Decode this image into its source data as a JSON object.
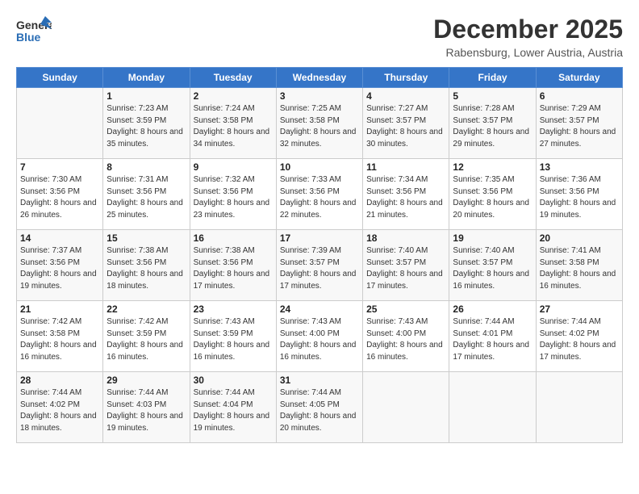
{
  "logo": {
    "line1": "General",
    "line2": "Blue"
  },
  "title": "December 2025",
  "subtitle": "Rabensburg, Lower Austria, Austria",
  "days_header": [
    "Sunday",
    "Monday",
    "Tuesday",
    "Wednesday",
    "Thursday",
    "Friday",
    "Saturday"
  ],
  "weeks": [
    [
      {
        "day": "",
        "sunrise": "",
        "sunset": "",
        "daylight": ""
      },
      {
        "day": "1",
        "sunrise": "Sunrise: 7:23 AM",
        "sunset": "Sunset: 3:59 PM",
        "daylight": "Daylight: 8 hours and 35 minutes."
      },
      {
        "day": "2",
        "sunrise": "Sunrise: 7:24 AM",
        "sunset": "Sunset: 3:58 PM",
        "daylight": "Daylight: 8 hours and 34 minutes."
      },
      {
        "day": "3",
        "sunrise": "Sunrise: 7:25 AM",
        "sunset": "Sunset: 3:58 PM",
        "daylight": "Daylight: 8 hours and 32 minutes."
      },
      {
        "day": "4",
        "sunrise": "Sunrise: 7:27 AM",
        "sunset": "Sunset: 3:57 PM",
        "daylight": "Daylight: 8 hours and 30 minutes."
      },
      {
        "day": "5",
        "sunrise": "Sunrise: 7:28 AM",
        "sunset": "Sunset: 3:57 PM",
        "daylight": "Daylight: 8 hours and 29 minutes."
      },
      {
        "day": "6",
        "sunrise": "Sunrise: 7:29 AM",
        "sunset": "Sunset: 3:57 PM",
        "daylight": "Daylight: 8 hours and 27 minutes."
      }
    ],
    [
      {
        "day": "7",
        "sunrise": "Sunrise: 7:30 AM",
        "sunset": "Sunset: 3:56 PM",
        "daylight": "Daylight: 8 hours and 26 minutes."
      },
      {
        "day": "8",
        "sunrise": "Sunrise: 7:31 AM",
        "sunset": "Sunset: 3:56 PM",
        "daylight": "Daylight: 8 hours and 25 minutes."
      },
      {
        "day": "9",
        "sunrise": "Sunrise: 7:32 AM",
        "sunset": "Sunset: 3:56 PM",
        "daylight": "Daylight: 8 hours and 23 minutes."
      },
      {
        "day": "10",
        "sunrise": "Sunrise: 7:33 AM",
        "sunset": "Sunset: 3:56 PM",
        "daylight": "Daylight: 8 hours and 22 minutes."
      },
      {
        "day": "11",
        "sunrise": "Sunrise: 7:34 AM",
        "sunset": "Sunset: 3:56 PM",
        "daylight": "Daylight: 8 hours and 21 minutes."
      },
      {
        "day": "12",
        "sunrise": "Sunrise: 7:35 AM",
        "sunset": "Sunset: 3:56 PM",
        "daylight": "Daylight: 8 hours and 20 minutes."
      },
      {
        "day": "13",
        "sunrise": "Sunrise: 7:36 AM",
        "sunset": "Sunset: 3:56 PM",
        "daylight": "Daylight: 8 hours and 19 minutes."
      }
    ],
    [
      {
        "day": "14",
        "sunrise": "Sunrise: 7:37 AM",
        "sunset": "Sunset: 3:56 PM",
        "daylight": "Daylight: 8 hours and 19 minutes."
      },
      {
        "day": "15",
        "sunrise": "Sunrise: 7:38 AM",
        "sunset": "Sunset: 3:56 PM",
        "daylight": "Daylight: 8 hours and 18 minutes."
      },
      {
        "day": "16",
        "sunrise": "Sunrise: 7:38 AM",
        "sunset": "Sunset: 3:56 PM",
        "daylight": "Daylight: 8 hours and 17 minutes."
      },
      {
        "day": "17",
        "sunrise": "Sunrise: 7:39 AM",
        "sunset": "Sunset: 3:57 PM",
        "daylight": "Daylight: 8 hours and 17 minutes."
      },
      {
        "day": "18",
        "sunrise": "Sunrise: 7:40 AM",
        "sunset": "Sunset: 3:57 PM",
        "daylight": "Daylight: 8 hours and 17 minutes."
      },
      {
        "day": "19",
        "sunrise": "Sunrise: 7:40 AM",
        "sunset": "Sunset: 3:57 PM",
        "daylight": "Daylight: 8 hours and 16 minutes."
      },
      {
        "day": "20",
        "sunrise": "Sunrise: 7:41 AM",
        "sunset": "Sunset: 3:58 PM",
        "daylight": "Daylight: 8 hours and 16 minutes."
      }
    ],
    [
      {
        "day": "21",
        "sunrise": "Sunrise: 7:42 AM",
        "sunset": "Sunset: 3:58 PM",
        "daylight": "Daylight: 8 hours and 16 minutes."
      },
      {
        "day": "22",
        "sunrise": "Sunrise: 7:42 AM",
        "sunset": "Sunset: 3:59 PM",
        "daylight": "Daylight: 8 hours and 16 minutes."
      },
      {
        "day": "23",
        "sunrise": "Sunrise: 7:43 AM",
        "sunset": "Sunset: 3:59 PM",
        "daylight": "Daylight: 8 hours and 16 minutes."
      },
      {
        "day": "24",
        "sunrise": "Sunrise: 7:43 AM",
        "sunset": "Sunset: 4:00 PM",
        "daylight": "Daylight: 8 hours and 16 minutes."
      },
      {
        "day": "25",
        "sunrise": "Sunrise: 7:43 AM",
        "sunset": "Sunset: 4:00 PM",
        "daylight": "Daylight: 8 hours and 16 minutes."
      },
      {
        "day": "26",
        "sunrise": "Sunrise: 7:44 AM",
        "sunset": "Sunset: 4:01 PM",
        "daylight": "Daylight: 8 hours and 17 minutes."
      },
      {
        "day": "27",
        "sunrise": "Sunrise: 7:44 AM",
        "sunset": "Sunset: 4:02 PM",
        "daylight": "Daylight: 8 hours and 17 minutes."
      }
    ],
    [
      {
        "day": "28",
        "sunrise": "Sunrise: 7:44 AM",
        "sunset": "Sunset: 4:02 PM",
        "daylight": "Daylight: 8 hours and 18 minutes."
      },
      {
        "day": "29",
        "sunrise": "Sunrise: 7:44 AM",
        "sunset": "Sunset: 4:03 PM",
        "daylight": "Daylight: 8 hours and 19 minutes."
      },
      {
        "day": "30",
        "sunrise": "Sunrise: 7:44 AM",
        "sunset": "Sunset: 4:04 PM",
        "daylight": "Daylight: 8 hours and 19 minutes."
      },
      {
        "day": "31",
        "sunrise": "Sunrise: 7:44 AM",
        "sunset": "Sunset: 4:05 PM",
        "daylight": "Daylight: 8 hours and 20 minutes."
      },
      {
        "day": "",
        "sunrise": "",
        "sunset": "",
        "daylight": ""
      },
      {
        "day": "",
        "sunrise": "",
        "sunset": "",
        "daylight": ""
      },
      {
        "day": "",
        "sunrise": "",
        "sunset": "",
        "daylight": ""
      }
    ]
  ]
}
